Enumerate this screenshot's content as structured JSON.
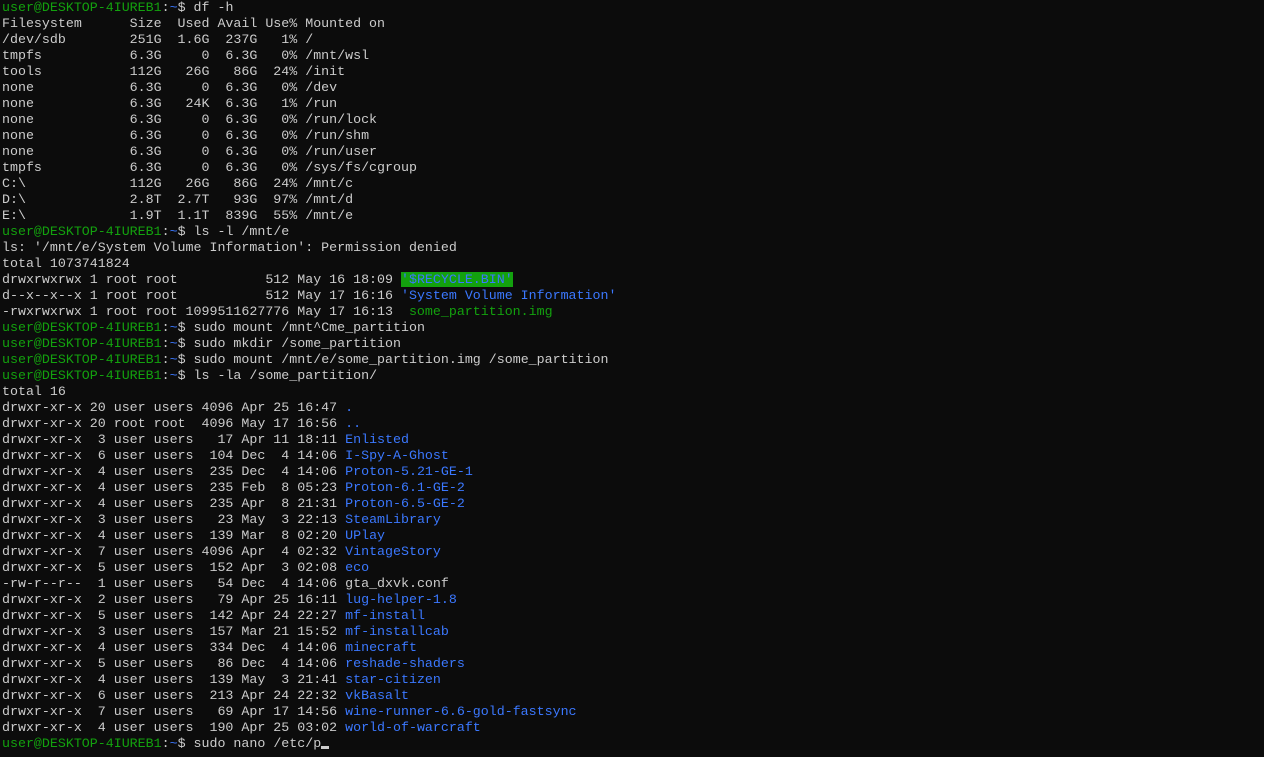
{
  "window": {
    "colors": {
      "background": "#0c0c0c",
      "foreground": "#cccccc",
      "prompt_user": "#13a10e",
      "prompt_path": "#3b78ff",
      "directory": "#3b78ff",
      "sticky_bg": "#13a10e"
    }
  },
  "prompt": {
    "user_host": "user@DESKTOP-4IUREB1",
    "sep": ":",
    "path": "~",
    "symbol": "$ "
  },
  "lines": [
    {
      "type": "prompt",
      "cmd": "df -h"
    },
    {
      "type": "text",
      "text": "Filesystem      Size  Used Avail Use% Mounted on"
    },
    {
      "type": "text",
      "text": "/dev/sdb        251G  1.6G  237G   1% /"
    },
    {
      "type": "text",
      "text": "tmpfs           6.3G     0  6.3G   0% /mnt/wsl"
    },
    {
      "type": "text",
      "text": "tools           112G   26G   86G  24% /init"
    },
    {
      "type": "text",
      "text": "none            6.3G     0  6.3G   0% /dev"
    },
    {
      "type": "text",
      "text": "none            6.3G   24K  6.3G   1% /run"
    },
    {
      "type": "text",
      "text": "none            6.3G     0  6.3G   0% /run/lock"
    },
    {
      "type": "text",
      "text": "none            6.3G     0  6.3G   0% /run/shm"
    },
    {
      "type": "text",
      "text": "none            6.3G     0  6.3G   0% /run/user"
    },
    {
      "type": "text",
      "text": "tmpfs           6.3G     0  6.3G   0% /sys/fs/cgroup"
    },
    {
      "type": "text",
      "text": "C:\\             112G   26G   86G  24% /mnt/c"
    },
    {
      "type": "text",
      "text": "D:\\             2.8T  2.7T   93G  97% /mnt/d"
    },
    {
      "type": "text",
      "text": "E:\\             1.9T  1.1T  839G  55% /mnt/e"
    },
    {
      "type": "prompt",
      "cmd": "ls -l /mnt/e"
    },
    {
      "type": "text",
      "text": "ls: '/mnt/e/System Volume Information': Permission denied"
    },
    {
      "type": "text",
      "text": "total 1073741824"
    },
    {
      "type": "entry",
      "meta": "drwxrwxrwx 1 root root           512 May 16 18:09 ",
      "name": "'$RECYCLE.BIN'",
      "style": "sticky"
    },
    {
      "type": "entry",
      "meta": "d--x--x--x 1 root root           512 May 17 16:16 ",
      "name": "'System Volume Information'",
      "style": "dir"
    },
    {
      "type": "entry",
      "meta": "-rwxrwxrwx 1 root root 1099511627776 May 17 16:13  ",
      "name": "some_partition.img",
      "style": "img"
    },
    {
      "type": "prompt",
      "cmd": "sudo mount /mnt^Cme_partition"
    },
    {
      "type": "prompt",
      "cmd": "sudo mkdir /some_partition"
    },
    {
      "type": "prompt",
      "cmd": "sudo mount /mnt/e/some_partition.img /some_partition"
    },
    {
      "type": "prompt",
      "cmd": "ls -la /some_partition/"
    },
    {
      "type": "text",
      "text": "total 16"
    },
    {
      "type": "entry",
      "meta": "drwxr-xr-x 20 user users 4096 Apr 25 16:47 ",
      "name": ".",
      "style": "dir"
    },
    {
      "type": "entry",
      "meta": "drwxr-xr-x 20 root root  4096 May 17 16:56 ",
      "name": "..",
      "style": "dir"
    },
    {
      "type": "entry",
      "meta": "drwxr-xr-x  3 user users   17 Apr 11 18:11 ",
      "name": "Enlisted",
      "style": "dir"
    },
    {
      "type": "entry",
      "meta": "drwxr-xr-x  6 user users  104 Dec  4 14:06 ",
      "name": "I-Spy-A-Ghost",
      "style": "dir"
    },
    {
      "type": "entry",
      "meta": "drwxr-xr-x  4 user users  235 Dec  4 14:06 ",
      "name": "Proton-5.21-GE-1",
      "style": "dir"
    },
    {
      "type": "entry",
      "meta": "drwxr-xr-x  4 user users  235 Feb  8 05:23 ",
      "name": "Proton-6.1-GE-2",
      "style": "dir"
    },
    {
      "type": "entry",
      "meta": "drwxr-xr-x  4 user users  235 Apr  8 21:31 ",
      "name": "Proton-6.5-GE-2",
      "style": "dir"
    },
    {
      "type": "entry",
      "meta": "drwxr-xr-x  3 user users   23 May  3 22:13 ",
      "name": "SteamLibrary",
      "style": "dir"
    },
    {
      "type": "entry",
      "meta": "drwxr-xr-x  4 user users  139 Mar  8 02:20 ",
      "name": "UPlay",
      "style": "dir"
    },
    {
      "type": "entry",
      "meta": "drwxr-xr-x  7 user users 4096 Apr  4 02:32 ",
      "name": "VintageStory",
      "style": "dir"
    },
    {
      "type": "entry",
      "meta": "drwxr-xr-x  5 user users  152 Apr  3 02:08 ",
      "name": "eco",
      "style": "dir"
    },
    {
      "type": "entry",
      "meta": "-rw-r--r--  1 user users   54 Dec  4 14:06 ",
      "name": "gta_dxvk.conf",
      "style": "file"
    },
    {
      "type": "entry",
      "meta": "drwxr-xr-x  2 user users   79 Apr 25 16:11 ",
      "name": "lug-helper-1.8",
      "style": "dir"
    },
    {
      "type": "entry",
      "meta": "drwxr-xr-x  5 user users  142 Apr 24 22:27 ",
      "name": "mf-install",
      "style": "dir"
    },
    {
      "type": "entry",
      "meta": "drwxr-xr-x  3 user users  157 Mar 21 15:52 ",
      "name": "mf-installcab",
      "style": "dir"
    },
    {
      "type": "entry",
      "meta": "drwxr-xr-x  4 user users  334 Dec  4 14:06 ",
      "name": "minecraft",
      "style": "dir"
    },
    {
      "type": "entry",
      "meta": "drwxr-xr-x  5 user users   86 Dec  4 14:06 ",
      "name": "reshade-shaders",
      "style": "dir"
    },
    {
      "type": "entry",
      "meta": "drwxr-xr-x  4 user users  139 May  3 21:41 ",
      "name": "star-citizen",
      "style": "dir"
    },
    {
      "type": "entry",
      "meta": "drwxr-xr-x  6 user users  213 Apr 24 22:32 ",
      "name": "vkBasalt",
      "style": "dir"
    },
    {
      "type": "entry",
      "meta": "drwxr-xr-x  7 user users   69 Apr 17 14:56 ",
      "name": "wine-runner-6.6-gold-fastsync",
      "style": "dir"
    },
    {
      "type": "entry",
      "meta": "drwxr-xr-x  4 user users  190 Apr 25 03:02 ",
      "name": "world-of-warcraft",
      "style": "dir"
    },
    {
      "type": "prompt",
      "cmd": "sudo nano /etc/p",
      "cursor": true
    }
  ]
}
